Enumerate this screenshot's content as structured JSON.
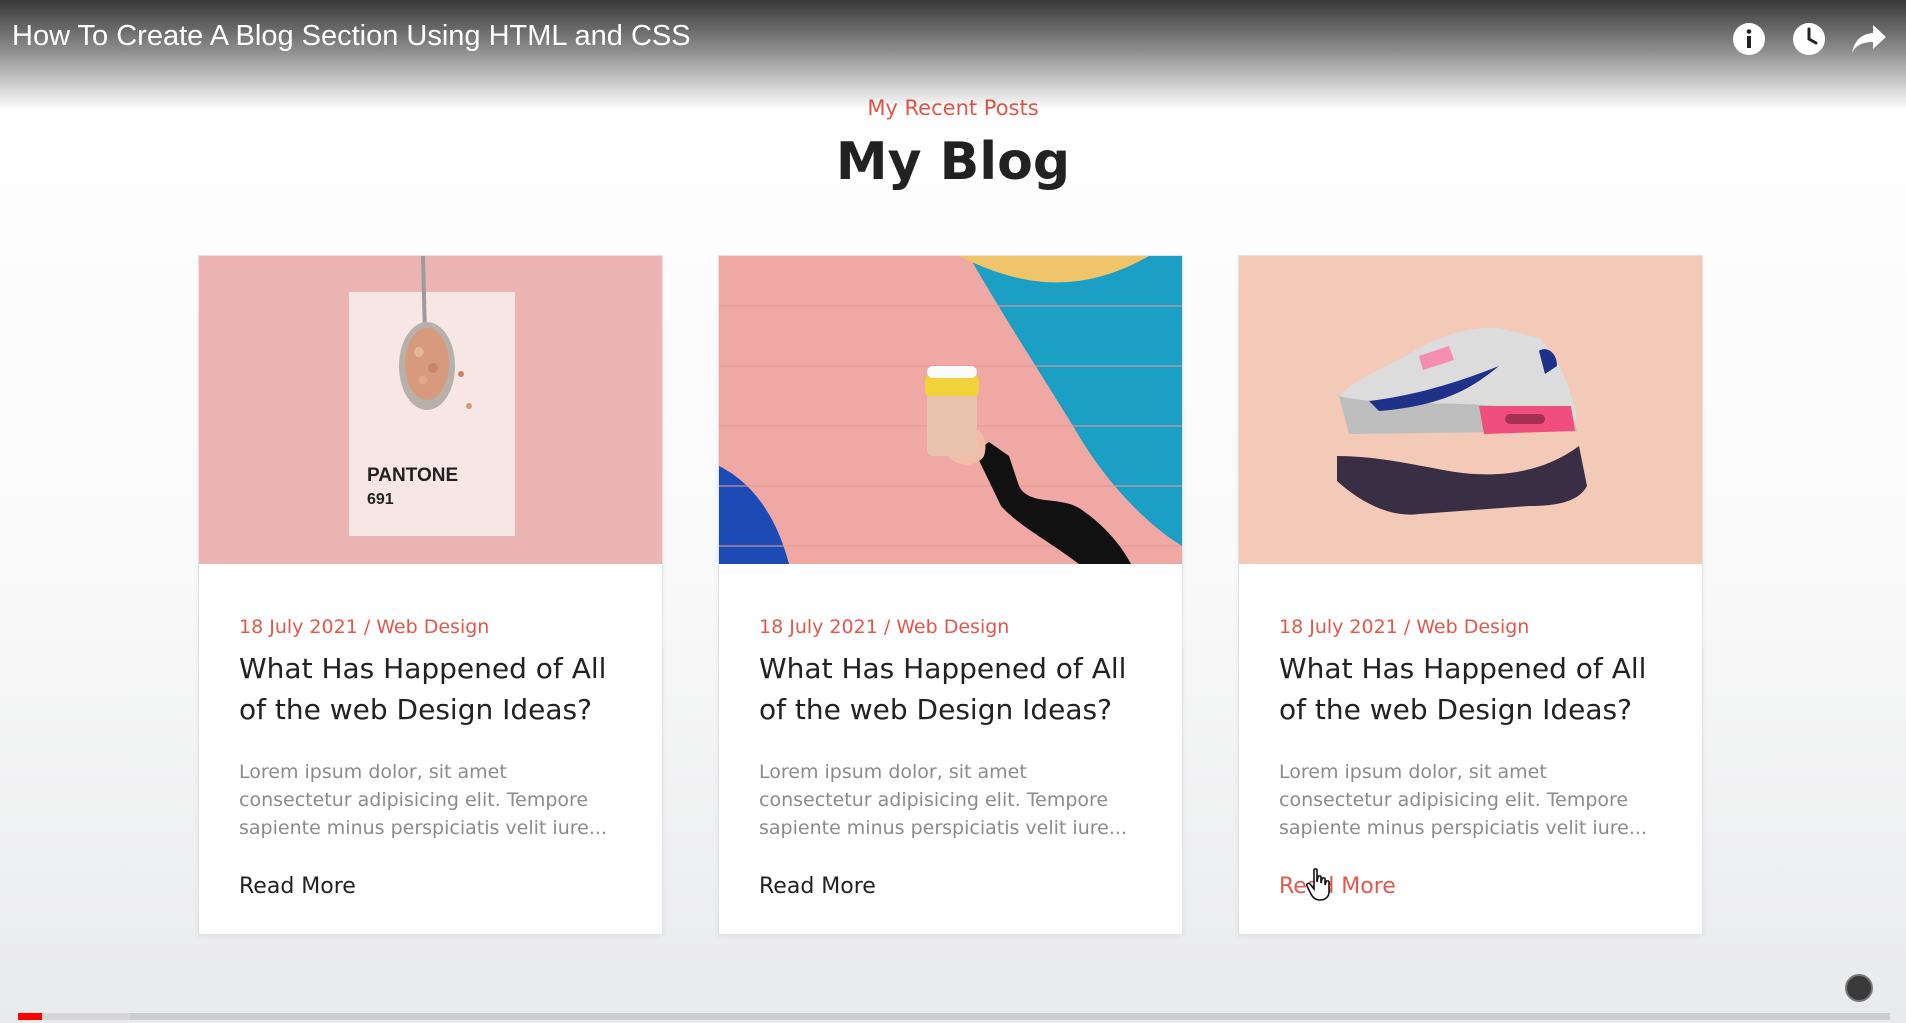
{
  "video": {
    "title": "How To Create A Blog Section Using HTML and CSS",
    "icons": [
      "info-icon",
      "watch-later-clock-icon",
      "share-arrow-icon"
    ],
    "progress": {
      "played_fraction": 0.013,
      "buffered_fraction": 0.06
    }
  },
  "blog": {
    "subtitle": "My Recent Posts",
    "title": "My Blog",
    "accent_color": "#e1584b",
    "posts": [
      {
        "image": "pantone-card-spoon",
        "image_text": {
          "brand": "PANTONE",
          "number": "691"
        },
        "meta": "18 July 2021 / Web Design",
        "title": "What Has Happened of All of the web Design Ideas?",
        "excerpt": "Lorem ipsum dolor, sit amet consectetur adipisicing elit. Tempore sapiente minus perspiciatis velit iure...",
        "read_more": "Read More"
      },
      {
        "image": "coffee-cup-colorful-wall",
        "meta": "18 July 2021 / Web Design",
        "title": "What Has Happened of All of the web Design Ideas?",
        "excerpt": "Lorem ipsum dolor, sit amet consectetur adipisicing elit. Tempore sapiente minus perspiciatis velit iure...",
        "read_more": "Read More"
      },
      {
        "image": "sneaker-on-hand",
        "meta": "18 July 2021 / Web Design",
        "title": "What Has Happened of All of the web Design Ideas?",
        "excerpt": "Lorem ipsum dolor, sit amet consectetur adipisicing elit. Tempore sapiente minus perspiciatis velit iure...",
        "read_more": "Read More"
      }
    ]
  }
}
